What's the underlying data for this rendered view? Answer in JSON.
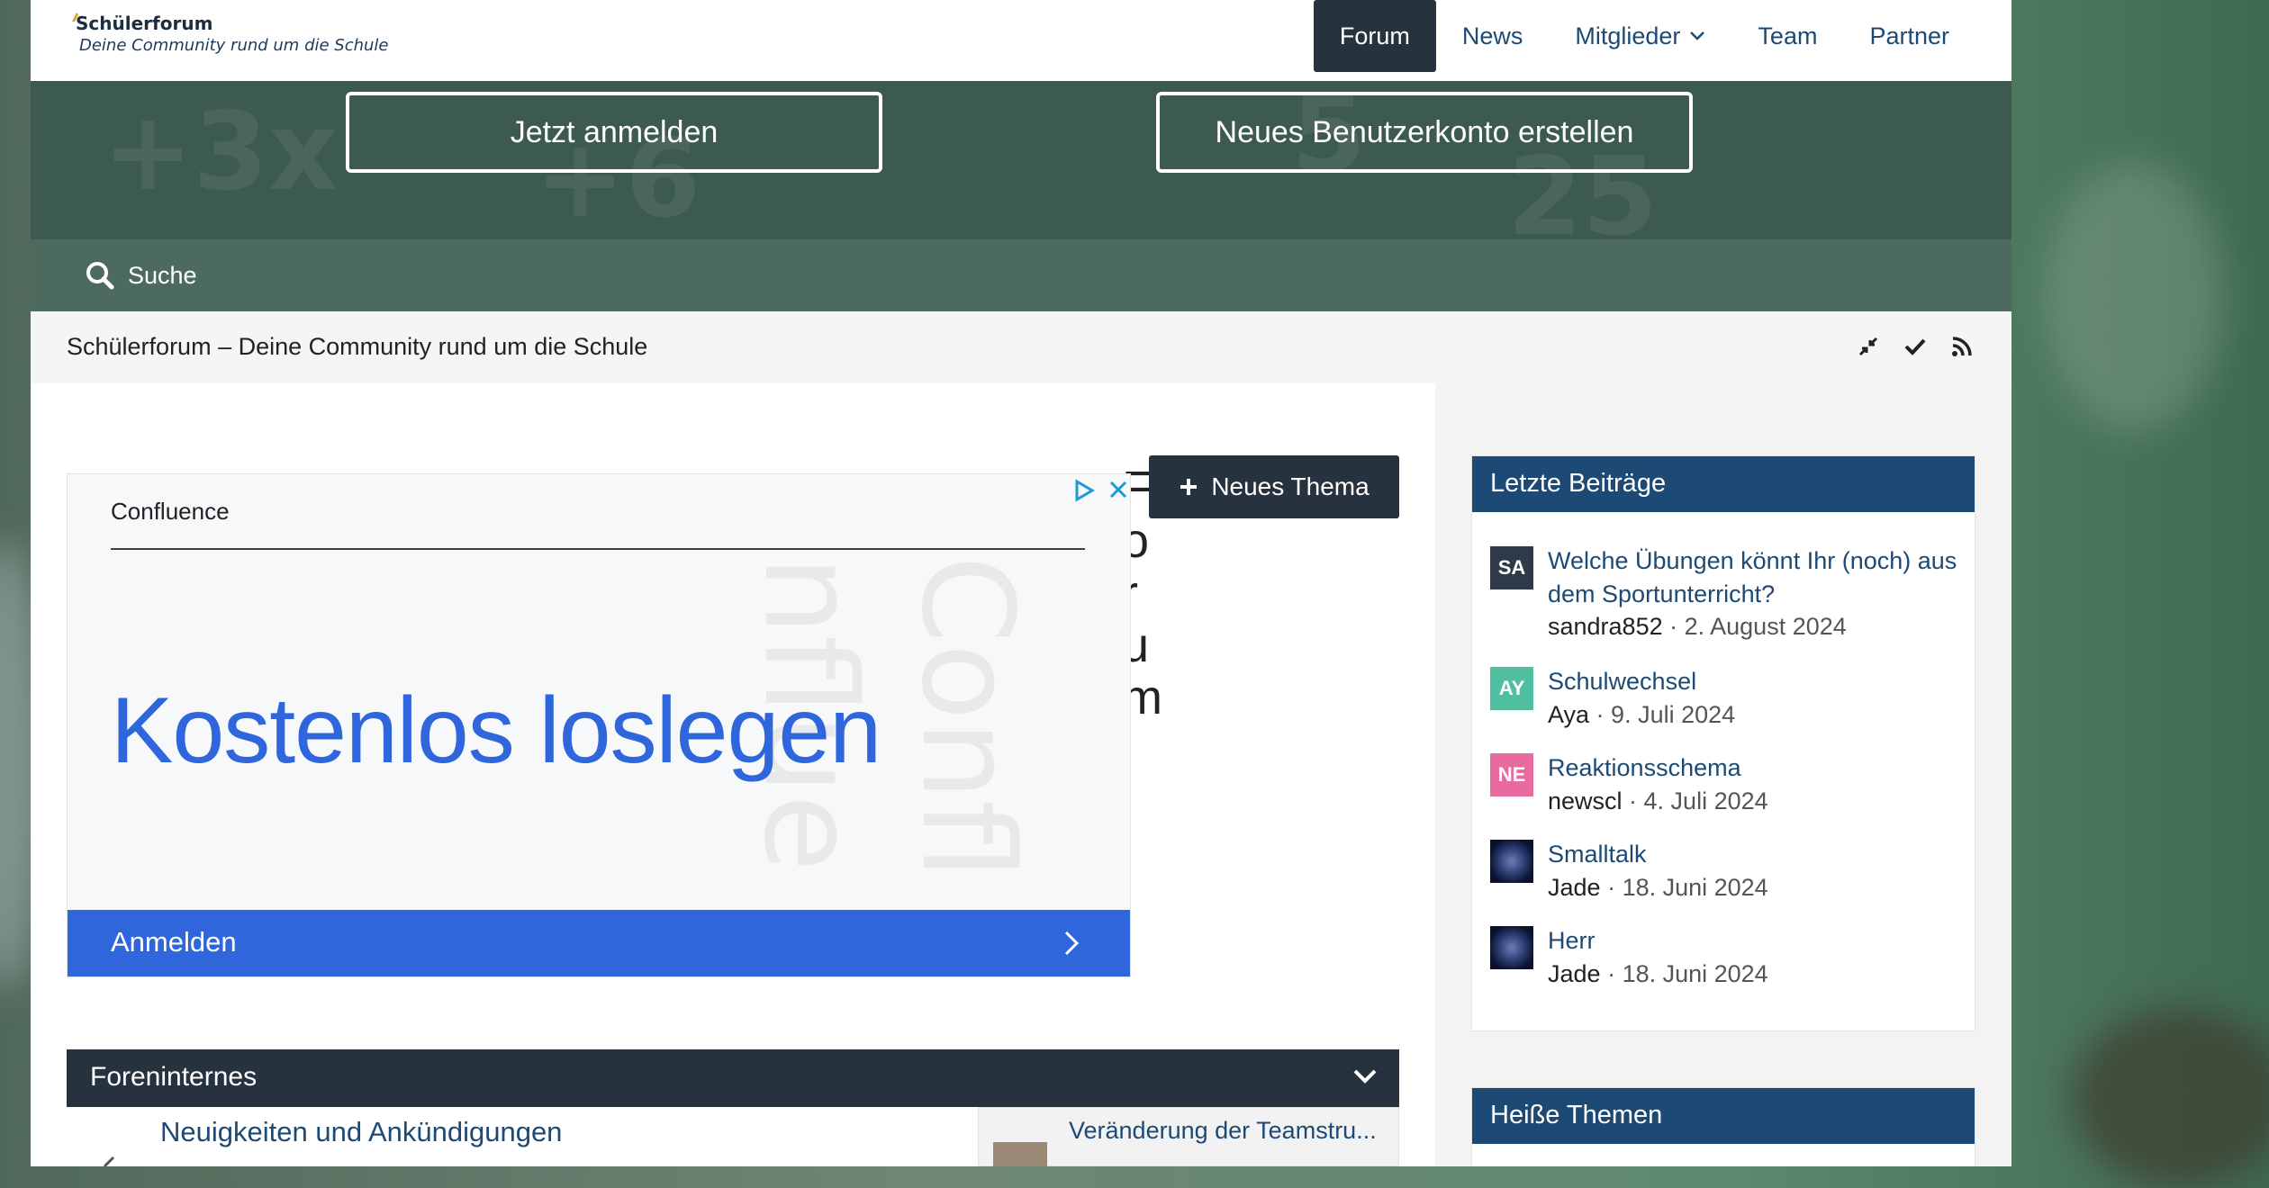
{
  "site": {
    "title": "Schülerforum",
    "subtitle": "Deine Community rund um die Schule"
  },
  "nav": {
    "items": [
      {
        "label": "Forum",
        "active": true
      },
      {
        "label": "News",
        "active": false
      },
      {
        "label": "Mitglieder",
        "active": false,
        "has_dropdown": true
      },
      {
        "label": "Team",
        "active": false
      },
      {
        "label": "Partner",
        "active": false
      }
    ]
  },
  "hero": {
    "login_label": "Jetzt anmelden",
    "register_label": "Neues Benutzerkonto erstellen"
  },
  "search": {
    "label": "Suche",
    "icon": "search-icon"
  },
  "breadcrumb": {
    "text": "Schülerforum – Deine Community rund um die Schule",
    "icons": [
      "collapse-icon",
      "checkmark-icon",
      "rss-icon"
    ]
  },
  "ad": {
    "brand": "Confluence",
    "headline": "Kostenlos loslegen",
    "cta_label": "Anmelden",
    "background_text": [
      "Confl",
      "nflue"
    ],
    "icons": [
      "adchoices-icon",
      "close-icon"
    ]
  },
  "main": {
    "partial_letters": [
      "F",
      "o",
      "r",
      "u",
      "m"
    ],
    "new_topic_label": "Neues Thema",
    "category": {
      "title": "Foreninternes",
      "forum_title": "Neuigkeiten und Ankündigungen",
      "last_post_title": "Veränderung der Teamstru..."
    }
  },
  "sidebar": {
    "latest": {
      "title": "Letzte Beiträge",
      "posts": [
        {
          "title": "Welche Übungen könnt Ihr (noch) aus dem Sportunterricht?",
          "user": "sandra852",
          "date": "2. August 2024",
          "avatar": "SA",
          "avatar_color": "#2e3a48"
        },
        {
          "title": "Schulwechsel",
          "user": "Aya",
          "date": "9. Juli 2024",
          "avatar": "AY",
          "avatar_color": "#4fbf9f"
        },
        {
          "title": "Reaktionsschema",
          "user": "newscl",
          "date": "4. Juli 2024",
          "avatar": "NE",
          "avatar_color": "#e86ba0"
        },
        {
          "title": "Smalltalk",
          "user": "Jade",
          "date": "18. Juni 2024",
          "avatar": "",
          "avatar_color": ""
        },
        {
          "title": "Herr",
          "user": "Jade",
          "date": "18. Juni 2024",
          "avatar": "",
          "avatar_color": ""
        }
      ]
    },
    "hot": {
      "title": "Heiße Themen"
    }
  },
  "colors": {
    "nav_active": "#27323f",
    "link": "#1d4a74",
    "header_block": "#1d4a74",
    "ad_blue": "#2f66db"
  }
}
